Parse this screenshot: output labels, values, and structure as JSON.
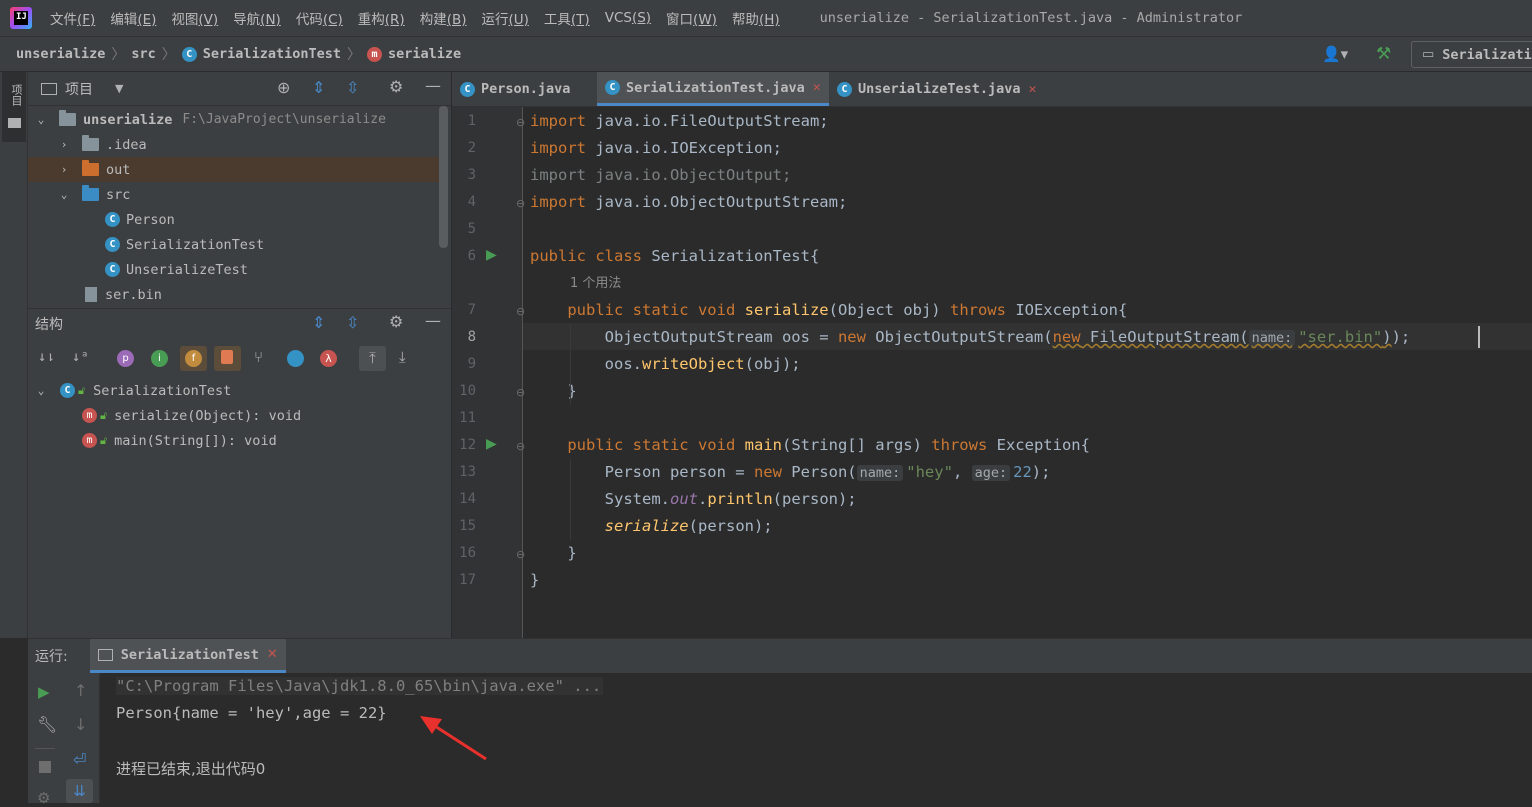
{
  "menubar": {
    "logo_text": "IJ",
    "items": [
      {
        "label": "文件",
        "key": "(F)"
      },
      {
        "label": "编辑",
        "key": "(E)"
      },
      {
        "label": "视图",
        "key": "(V)"
      },
      {
        "label": "导航",
        "key": "(N)"
      },
      {
        "label": "代码",
        "key": "(C)"
      },
      {
        "label": "重构",
        "key": "(R)"
      },
      {
        "label": "构建",
        "key": "(B)"
      },
      {
        "label": "运行",
        "key": "(U)"
      },
      {
        "label": "工具",
        "key": "(T)"
      },
      {
        "label": "VCS",
        "key": "(S)"
      },
      {
        "label": "窗口",
        "key": "(W)"
      },
      {
        "label": "帮助",
        "key": "(H)"
      }
    ],
    "window_title": "unserialize - SerializationTest.java - Administrator"
  },
  "navbar": {
    "crumbs": [
      "unserialize",
      "src",
      "SerializationTest",
      "serialize"
    ],
    "run_config": "Serializati"
  },
  "leftstripe": {
    "tab_label": "项目"
  },
  "project": {
    "title": "项目",
    "root_name": "unserialize",
    "root_path": "F:\\JavaProject\\unserialize",
    "items": [
      ".idea",
      "out",
      "src",
      "Person",
      "SerializationTest",
      "UnserializeTest",
      "ser.bin"
    ]
  },
  "structure": {
    "title": "结构",
    "class_name": "SerializationTest",
    "members": [
      "serialize(Object): void",
      "main(String[]): void"
    ],
    "filter_letters": [
      "p",
      "i",
      "f",
      "λ"
    ]
  },
  "editor": {
    "tabs": [
      "Person.java",
      "SerializationTest.java",
      "UnserializeTest.java"
    ],
    "active_tab": "SerializationTest.java",
    "line_numbers": [
      "1",
      "2",
      "3",
      "4",
      "5",
      "6",
      "7",
      "8",
      "9",
      "10",
      "11",
      "12",
      "13",
      "14",
      "15",
      "16",
      "17"
    ],
    "usage_hint": "1 个用法",
    "hints": {
      "name": "name:",
      "age": "age:"
    },
    "strings": {
      "ser_bin": "\"ser.bin\"",
      "hey": "\"hey\""
    },
    "numbers": {
      "age": "22"
    }
  },
  "run": {
    "label": "运行:",
    "tab": "SerializationTest",
    "output": [
      "\"C:\\Program Files\\Java\\jdk1.8.0_65\\bin\\java.exe\" ...",
      "Person{name = 'hey',age = 22}",
      "进程已结束,退出代码0"
    ]
  },
  "colors": {
    "accent": "#4a88c7",
    "keyword": "#cc7832",
    "method": "#ffc66d",
    "string": "#6a8759",
    "number": "#6897bb",
    "annotation_arrow": "#e8302c"
  }
}
